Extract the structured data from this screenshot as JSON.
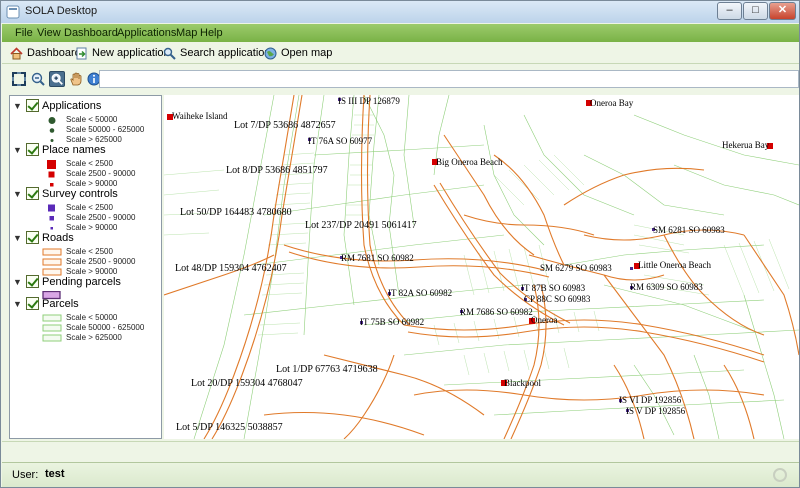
{
  "window": {
    "title": "SOLA Desktop",
    "buttons": {
      "minimize": "–",
      "maximize": "□",
      "close": "✕"
    }
  },
  "menu": [
    "File",
    "View",
    "Dashboard",
    "Applications",
    "Map",
    "Help"
  ],
  "toolbar": {
    "dashboard": "Dashboard",
    "new_application": "New application",
    "search_applications": "Search applications",
    "open_map": "Open map"
  },
  "map_tools": [
    "zoom-to-extent",
    "zoom-out",
    "zoom-in",
    "pan",
    "info"
  ],
  "layers": [
    {
      "name": "Applications",
      "items": [
        "Scale < 50000",
        "Scale 50000 - 625000",
        "Scale > 625000"
      ]
    },
    {
      "name": "Place names",
      "items": [
        "Scale < 2500",
        "Scale 2500 - 90000",
        "Scale > 90000"
      ]
    },
    {
      "name": "Survey controls",
      "items": [
        "Scale < 2500",
        "Scale 2500 - 90000",
        "Scale > 90000"
      ]
    },
    {
      "name": "Roads",
      "items": [
        "Scale < 2500",
        "Scale 2500 - 90000",
        "Scale > 90000"
      ]
    },
    {
      "name": "Pending parcels",
      "items": []
    },
    {
      "name": "Parcels",
      "items": [
        "Scale < 50000",
        "Scale 50000 - 625000",
        "Scale > 625000"
      ]
    }
  ],
  "map": {
    "place_names": [
      "Waiheke Island",
      "Oneroa Bay",
      "Big Oneroa Beach",
      "Hekerua Bay",
      "Little Oneroa Beach",
      "Oneroa",
      "Blackpool"
    ],
    "survey_controls": [
      "IS III DP 126879",
      "IT 76A SO 60977",
      "SM 6281 SO 60983",
      "RM 7681 SO 60982",
      "SM 6279 SO 60983",
      "RM 6309 SO 60983",
      "IT 82A SO 60982",
      "IT 87B SO 60983",
      "CP 88C SO 60983",
      "RM 7686 SO 60982",
      "IT 75B SO 60982",
      "IS VI DP 192856",
      "IS V DP 192856"
    ],
    "parcel_labels": [
      "Lot 7/DP 53686 4872657",
      "Lot 8/DP 53686 4851797",
      "Lot 50/DP 164483 4780680",
      "Lot 237/DP 20491 5061417",
      "Lot 48/DP 159304 4762407",
      "Lot 1/DP 67763 4719638",
      "Lot 20/DP 159304 4768047",
      "Lot 5/DP 146325 5038857"
    ]
  },
  "status": {
    "user_label": "User:",
    "user_name": "test"
  },
  "colors": {
    "menubar": "#79b246",
    "roads": "#e07a2a",
    "parcels": "#8fcf7a",
    "place_marker": "#d40000",
    "survey_marker": "#4b2a8c"
  }
}
